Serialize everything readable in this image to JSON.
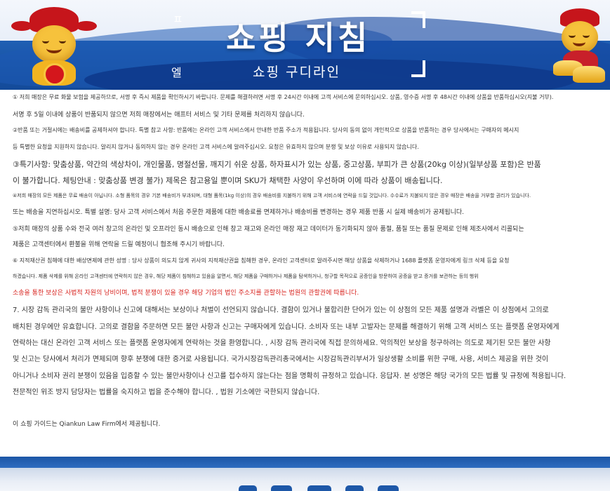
{
  "header": {
    "title": "쇼핑 지침",
    "subtitle": "쇼핑 구디라인",
    "glyph_top": "ㅍ",
    "glyph_bottom": "엘"
  },
  "lines": [
    "① 저희 매장은 무료 화물 보험을 제공하므로, 서명 후 즉시 제품을 확인하시기 바랍니다. 문제를 해결하려면 서명 후 24시간 이내에 고객 서비스에 문의하십시오. 상품, 영수증 서명 후 48시간 이내에 상품을 반품하십시오(지불 거부).",
    "서명 후 5일 이내에 상품이 반품되지 않으면 저희 매장에서는 애프터 서비스 및 기타 문제를 처리하지 않습니다.",
    "②반품 또는 거절시에는 배송비를 공제하셔야 합니다. 특별 참고 사항: 반품에는 온라인 고객 서비스에서 안내한 반품 주소가 적용됩니다. 당사의 동의 없이 개인적으로 상품을 반품하는 경우 당사에서는 구매자의 메시지",
    "등 특별한 요청을 지원하지 않습니다. 알리지 않거나 동의하지 않는 경우 온라인 고객 서비스에 알려주십시오. 요청은 유효하지 않으며 분쟁 및 보상 이유로 사용되지 않습니다.",
    "③특기사항: 맞춤상품, 약간의 색상차이, 개인물품, 명절선물, 깨지기 쉬운 상품, 하자표시가 있는 상품, 중고상품, 부피가 큰 상품(20kg 이상)(일부상품 포함)은 반품",
    "이 불가합니다. 체팅안내 : 맞춤상품 변경 불가) 제목은 참고용일 뿐이며 SKU가 채택한 사양이 우선하며 이에 따라 상품이 배송됩니다.",
    "④저희 매장의 모든 제품은 무료 배송이 아닙니다. 소형 품목의 경우 기본 배송비가 부과되며, 대형 품목(1kg 이상)의 경우 배송비를 지불하기 위해 고객 서비스에 연락을 드릴 것입니다. 수수료가 지불되지 않은 경우 매장은 배송을 거부할 권리가 있습니다.",
    "또는 배송을 지연하십시오. 특별 설명: 당사 고객 서비스에서 처음 주문한 제품에 대한 배송료를 면제하거나 배송비를 변경하는 경우 제품 반품 시 실제 배송비가 공제됩니다.",
    "⑤저희 매장의 상품 수와 전국 여러 창고의 온라인 및 오프라인 동시 배송으로 인해 창고 재고와 온라인 매장 재고 데이터가 동기화되지 않아 품절, 품질 또는 품질 문제로 인해 제조사에서 리콜되는",
    "제품은 고객센터에서 환불을 위해 연락을 드릴 예정이니 협조해 주시기 바랍니다.",
    "⑥ 지적재산권 침해에 대한 배상면제에 관한 성명 : 당사 상품이 의도치 않게 귀사의 지적재산권을 침해한 경우, 온라인 고객센터로 알려주시면 해당 상품을 삭제하거나 1688 플랫폼 운영자에게 링크 삭제 등을 요청",
    "하겠습니다. 제품 삭제를 위해 온라인 고객센터에 연락하지 않은 경우, 해당 제품이 침해하고 있음을 알면서, 해당 제품을 구매하거나 제품을 탐색하거나, 청구할 목적으로 공증인을 방문하여 공증을 받고 증거를 보관하는 등의 행위",
    "소송을 통한 보상은 사법적 자원의 낭비이며, 법적 분쟁이 있을 경우 해당 기업의 법인 주소지를 관할하는 법원의 관할권에 따릅니다.",
    "7. 시장 감독 관리국의 불만 사항이나 신고에 대해서는 보상이나 처벌이 선언되지 않습니다. 결함이 있거나 불합리한 단어가 있는 이 상점의 모든 제품 설명과 라벨은 이 상점에서 고의로",
    "배치된 경우에만 유효합니다. 고의로 결함을 주문하면 모든 불만 사항과 신고는 구매자에게 있습니다. 소비자 또는 내부 고발자는 문제를 해결하기 위해 고객 서비스 또는 플랫폼 운영자에게",
    "연락하는 대신 온라인 고객 서비스 또는 플랫폼 운영자에게 연락하는 것을 환영합니다. , 시장 감독 관리국에 직접 문의하세요. 악의적인 보상을 청구하려는 의도로 제기된 모든 불만 사항",
    "및 신고는 당사에서 처리가 면제되며 향후 분쟁에 대한 증거로 사용됩니다. 국가시장감독관리총국에서는 시장감독관리부서가 일상생활 소비를 위한 구매, 사용, 서비스 제공을 위한 것이",
    "아니거나 소비자 권리 분쟁이 있음을 입증할 수 있는 불만사항이나 신고를 접수하지 않는다는 점을 명확히 규정하고 있습니다. 응답자. 본 성명은 해당 국가의 모든 법률 및 규정에 적용됩니다.",
    "전문적인 위조 방지 담당자는 법률을 숙지하고 법을 준수해야 합니다. , 법원 기소에만 국한되지 않습니다.",
    "이 쇼핑 가이드는 Qiankun Law Firm에서 제공됩니다."
  ],
  "colors": {
    "banner_blue": "#1f5fb3",
    "text": "#333333",
    "highlight_red": "#d8241f"
  },
  "icons": {
    "left": "fortune-god-mascot-icon",
    "right": "fortune-god-with-gold-ingots-icon"
  }
}
